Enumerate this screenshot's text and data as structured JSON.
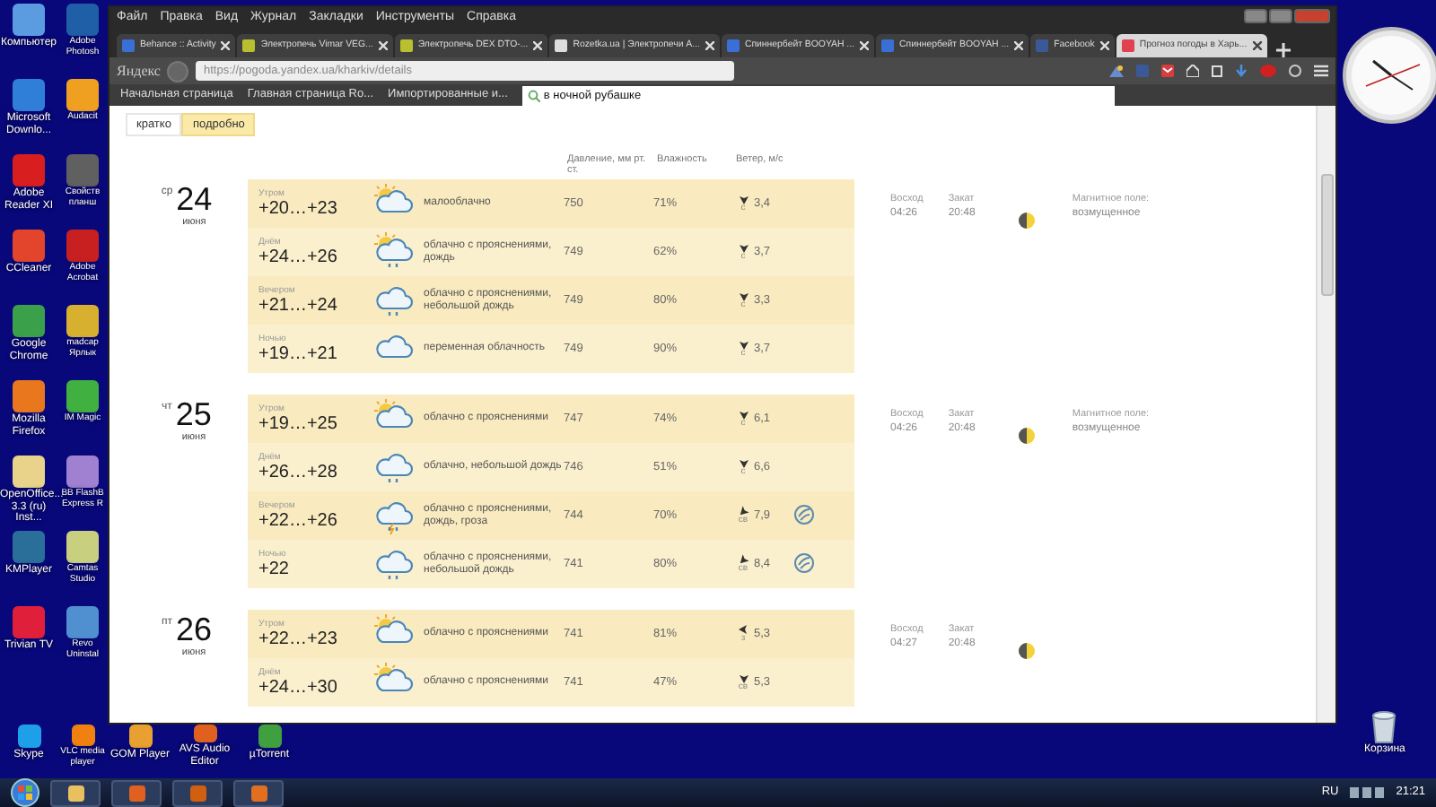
{
  "desktop": {
    "column_1": [
      {
        "label": "Компьютер",
        "color": "#5b9be0"
      },
      {
        "label": "Microsoft Downlo...",
        "color": "#2f7fd8"
      },
      {
        "label": "Adobe Reader XI",
        "color": "#d81e1e"
      },
      {
        "label": "CCleaner",
        "color": "#e2452b"
      },
      {
        "label": "Google Chrome",
        "color": "#3aa04a"
      },
      {
        "label": "Mozilla Firefox",
        "color": "#e8771e"
      },
      {
        "label": "OpenOffice... 3.3 (ru) Inst...",
        "color": "#e9d38a"
      },
      {
        "label": "KMPlayer",
        "color": "#2a6f9a"
      },
      {
        "label": "Trivian TV",
        "color": "#e0203a"
      },
      {
        "label": "Skype",
        "color": "#1ea0e8"
      }
    ],
    "column_2": [
      {
        "label": "Adobe Photosh",
        "color": "#1f5fa8"
      },
      {
        "label": "Audacit",
        "color": "#f0a020"
      },
      {
        "label": "Свойств планш",
        "color": "#606060"
      },
      {
        "label": "Adobe Acrobat",
        "color": "#c82020"
      },
      {
        "label": "madcap Ярлык",
        "color": "#d8b030"
      },
      {
        "label": "IM Magic",
        "color": "#40b040"
      },
      {
        "label": "BB FlashB Express R",
        "color": "#a080d0"
      },
      {
        "label": "Camtas Studio",
        "color": "#c8d080"
      },
      {
        "label": "Revo Uninstal",
        "color": "#5090d0"
      },
      {
        "label": "VLC media player",
        "color": "#f08010"
      }
    ],
    "bottom_row": [
      {
        "label": "GOM Player",
        "color": "#e8a030"
      },
      {
        "label": "AVS Audio Editor",
        "color": "#e06020"
      },
      {
        "label": "µTorrent",
        "color": "#40a040"
      }
    ],
    "recycle_bin": "Корзина"
  },
  "browser": {
    "menu": [
      "Файл",
      "Правка",
      "Вид",
      "Журнал",
      "Закладки",
      "Инструменты",
      "Справка"
    ],
    "tabs": [
      {
        "label": "Behance :: Activity",
        "selected": false
      },
      {
        "label": "Электропечь Vimar VEG...",
        "selected": false
      },
      {
        "label": "Электропечь DEX DTO-...",
        "selected": false
      },
      {
        "label": "Rozetka.ua | Электропечи А...",
        "selected": false
      },
      {
        "label": "Спиннербейт BOOYAH ...",
        "selected": false
      },
      {
        "label": "Спиннербейт BOOYAH ...",
        "selected": false
      },
      {
        "label": "Facebook",
        "selected": false
      },
      {
        "label": "Прогноз погоды в Харь...",
        "selected": true
      }
    ],
    "search_engine": "Яндекс",
    "url": "https://pogoda.yandex.ua/kharkiv/details",
    "bookmarks": [
      "Начальная страница",
      "Главная страница Rо...",
      "Импортированные и..."
    ],
    "bookmark_search": "в ночной рубашке"
  },
  "forecast": {
    "view_toggle": [
      {
        "label": "кратко",
        "selected": false
      },
      {
        "label": "подробно",
        "selected": true
      }
    ],
    "columns": [
      "Давление, мм рт. ст.",
      "Влажность",
      "Ветер, м/с"
    ],
    "days": [
      {
        "weekday": "ср",
        "day": "24",
        "month": "июня",
        "sunrise_label": "Восход",
        "sunrise": "04:26",
        "sunset_label": "Закат",
        "sunset": "20:48",
        "magnetic_label": "Магнитное поле:",
        "magnetic": "возмущенное",
        "parts": [
          {
            "period": "Утром",
            "temp": "+20…+23",
            "kind": "sun-cloud",
            "condition": "малооблачно",
            "pressure": "750",
            "humidity": "71%",
            "wind": {
              "kind": "down",
              "direction": "с",
              "speed": "3,4"
            },
            "storm_warning": false
          },
          {
            "period": "Днём",
            "temp": "+24…+26",
            "kind": "sun-cloud-rain",
            "condition": "облачно с прояснениями, дождь",
            "pressure": "749",
            "humidity": "62%",
            "wind": {
              "kind": "down",
              "direction": "с",
              "speed": "3,7"
            },
            "storm_warning": false
          },
          {
            "period": "Вечером",
            "temp": "+21…+24",
            "kind": "cloud-rain",
            "condition": "облачно с прояснениями, небольшой дождь",
            "pressure": "749",
            "humidity": "80%",
            "wind": {
              "kind": "down",
              "direction": "с",
              "speed": "3,3"
            },
            "storm_warning": false
          },
          {
            "period": "Ночью",
            "temp": "+19…+21",
            "kind": "cloud",
            "condition": "переменная облачность",
            "pressure": "749",
            "humidity": "90%",
            "wind": {
              "kind": "down",
              "direction": "с",
              "speed": "3,7"
            },
            "storm_warning": false
          }
        ]
      },
      {
        "weekday": "чт",
        "day": "25",
        "month": "июня",
        "sunrise_label": "Восход",
        "sunrise": "04:26",
        "sunset_label": "Закат",
        "sunset": "20:48",
        "magnetic_label": "Магнитное поле:",
        "magnetic": "возмущенное",
        "parts": [
          {
            "period": "Утром",
            "temp": "+19…+25",
            "kind": "sun-cloud",
            "condition": "облачно с прояснениями",
            "pressure": "747",
            "humidity": "74%",
            "wind": {
              "kind": "down",
              "direction": "с",
              "speed": "6,1"
            },
            "storm_warning": false
          },
          {
            "period": "Днём",
            "temp": "+26…+28",
            "kind": "cloud-rain",
            "condition": "облачно, небольшой дождь",
            "pressure": "746",
            "humidity": "51%",
            "wind": {
              "kind": "down",
              "direction": "с",
              "speed": "6,6"
            },
            "storm_warning": false
          },
          {
            "period": "Вечером",
            "temp": "+22…+26",
            "kind": "cloud-storm",
            "condition": "облачно с прояснениями, дождь, гроза",
            "pressure": "744",
            "humidity": "70%",
            "wind": {
              "kind": "down-left",
              "direction": "св",
              "speed": "7,9"
            },
            "storm_warning": true
          },
          {
            "period": "Ночью",
            "temp": "+22",
            "kind": "cloud-rain",
            "condition": "облачно с прояснениями, небольшой дождь",
            "pressure": "741",
            "humidity": "80%",
            "wind": {
              "kind": "down-left",
              "direction": "св",
              "speed": "8,4"
            },
            "storm_warning": true
          }
        ]
      },
      {
        "weekday": "пт",
        "day": "26",
        "month": "июня",
        "sunrise_label": "Восход",
        "sunrise": "04:27",
        "sunset_label": "Закат",
        "sunset": "20:48",
        "parts": [
          {
            "period": "Утром",
            "temp": "+22…+23",
            "kind": "sun-cloud",
            "condition": "облачно с прояснениями",
            "pressure": "741",
            "humidity": "81%",
            "wind": {
              "kind": "left",
              "direction": "з",
              "speed": "5,3"
            },
            "storm_warning": false
          },
          {
            "period": "Днём",
            "temp": "+24…+30",
            "kind": "sun-cloud",
            "condition": "облачно с прояснениями",
            "pressure": "741",
            "humidity": "47%",
            "wind": {
              "kind": "down",
              "direction": "св",
              "speed": "5,3"
            },
            "storm_warning": false
          }
        ]
      }
    ]
  },
  "taskbar": {
    "language": "RU",
    "time": "21:21"
  }
}
